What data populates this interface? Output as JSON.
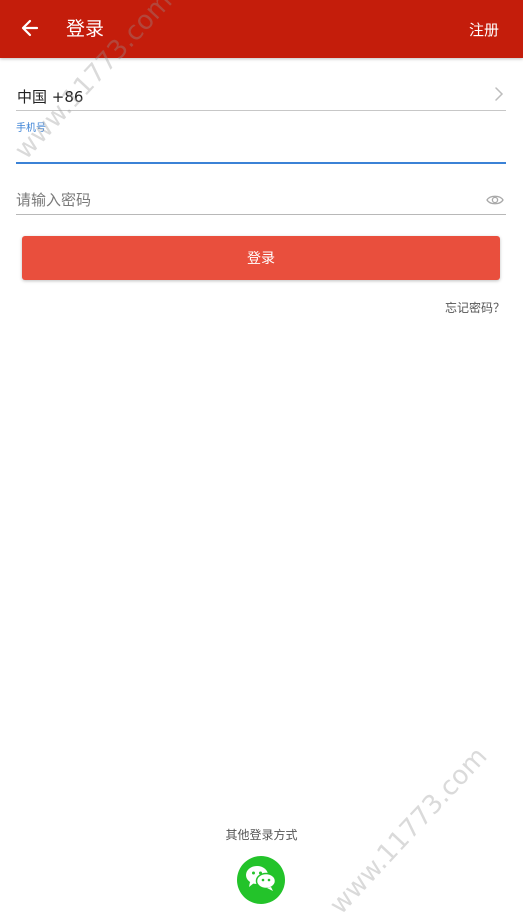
{
  "header": {
    "title": "登录",
    "register_label": "注册"
  },
  "icons": {
    "back": "arrow-left-icon",
    "chevron": "chevron-right-icon",
    "eye": "eye-icon",
    "wechat": "wechat-icon"
  },
  "form": {
    "country_code": "中国 +86",
    "phone_label": "手机号",
    "phone_value": "",
    "password_placeholder": "请输入密码",
    "login_label": "登录",
    "forgot_label": "忘记密码？"
  },
  "footer": {
    "other_login_label": "其他登录方式"
  },
  "watermark": {
    "text": "www.11773.com"
  },
  "colors": {
    "header_bg": "#c41d0b",
    "login_button": "#e94f3d",
    "focus_blue": "#3b82d6",
    "wechat_green": "#23c32a"
  }
}
